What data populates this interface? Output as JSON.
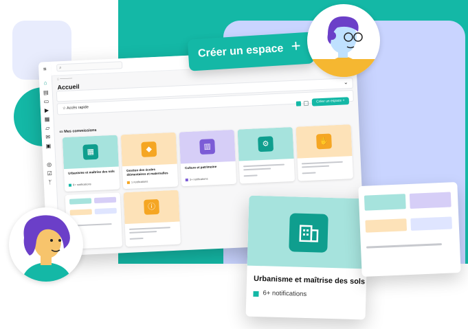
{
  "topbar": {
    "search_placeholder": ""
  },
  "page": {
    "title": "Accueil"
  },
  "quick_access": {
    "label": "Accès rapide"
  },
  "actions": {
    "create_space_label": "Créer un espace",
    "plus_symbol": "+",
    "mini_create_label": "Créer un espace +"
  },
  "commissions": {
    "title": "Mes commissions",
    "cards": [
      {
        "name": "Urbanisme et maîtrise des sols",
        "notifications": "6+ notifications",
        "color": "#a6e3dd",
        "icon_color": "#0f9e8e",
        "dot_color": "#14b8a6",
        "icon": "building-icon"
      },
      {
        "name": "Gestion des écoles élémentaires et maternelles",
        "notifications": "1 notifications",
        "color": "#fde2b8",
        "icon_color": "#f5a623",
        "dot_color": "#f5a623",
        "icon": "graduation-cap-icon"
      },
      {
        "name": "Culture et patrimoine",
        "notifications": "3+ notifications",
        "color": "#d6cef7",
        "icon_color": "#7c5cd6",
        "dot_color": "#7c5cd6",
        "icon": "monument-icon"
      },
      {
        "name": "",
        "notifications": "",
        "color": "#a6e3dd",
        "icon_color": "#0f9e8e",
        "dot_color": "#14b8a6",
        "icon": "gear-icon"
      },
      {
        "name": "",
        "notifications": "",
        "color": "#fde2b8",
        "icon_color": "#f5a623",
        "dot_color": "#f5a623",
        "icon": "hand-icon"
      },
      {
        "name": "",
        "notifications": "",
        "color": "#fde2b8",
        "icon_color": "#f5a623",
        "dot_color": "#f5a623",
        "icon": "info-icon"
      }
    ]
  },
  "featured_card": {
    "name": "Urbanisme et maîtrise des sols",
    "notifications": "6+ notifications"
  },
  "colors": {
    "teal": "#14b8a6",
    "blue": "#c9d4ff",
    "lavender": "#e8ecfd",
    "orange": "#fde2b8",
    "purple": "#d6cef7"
  }
}
